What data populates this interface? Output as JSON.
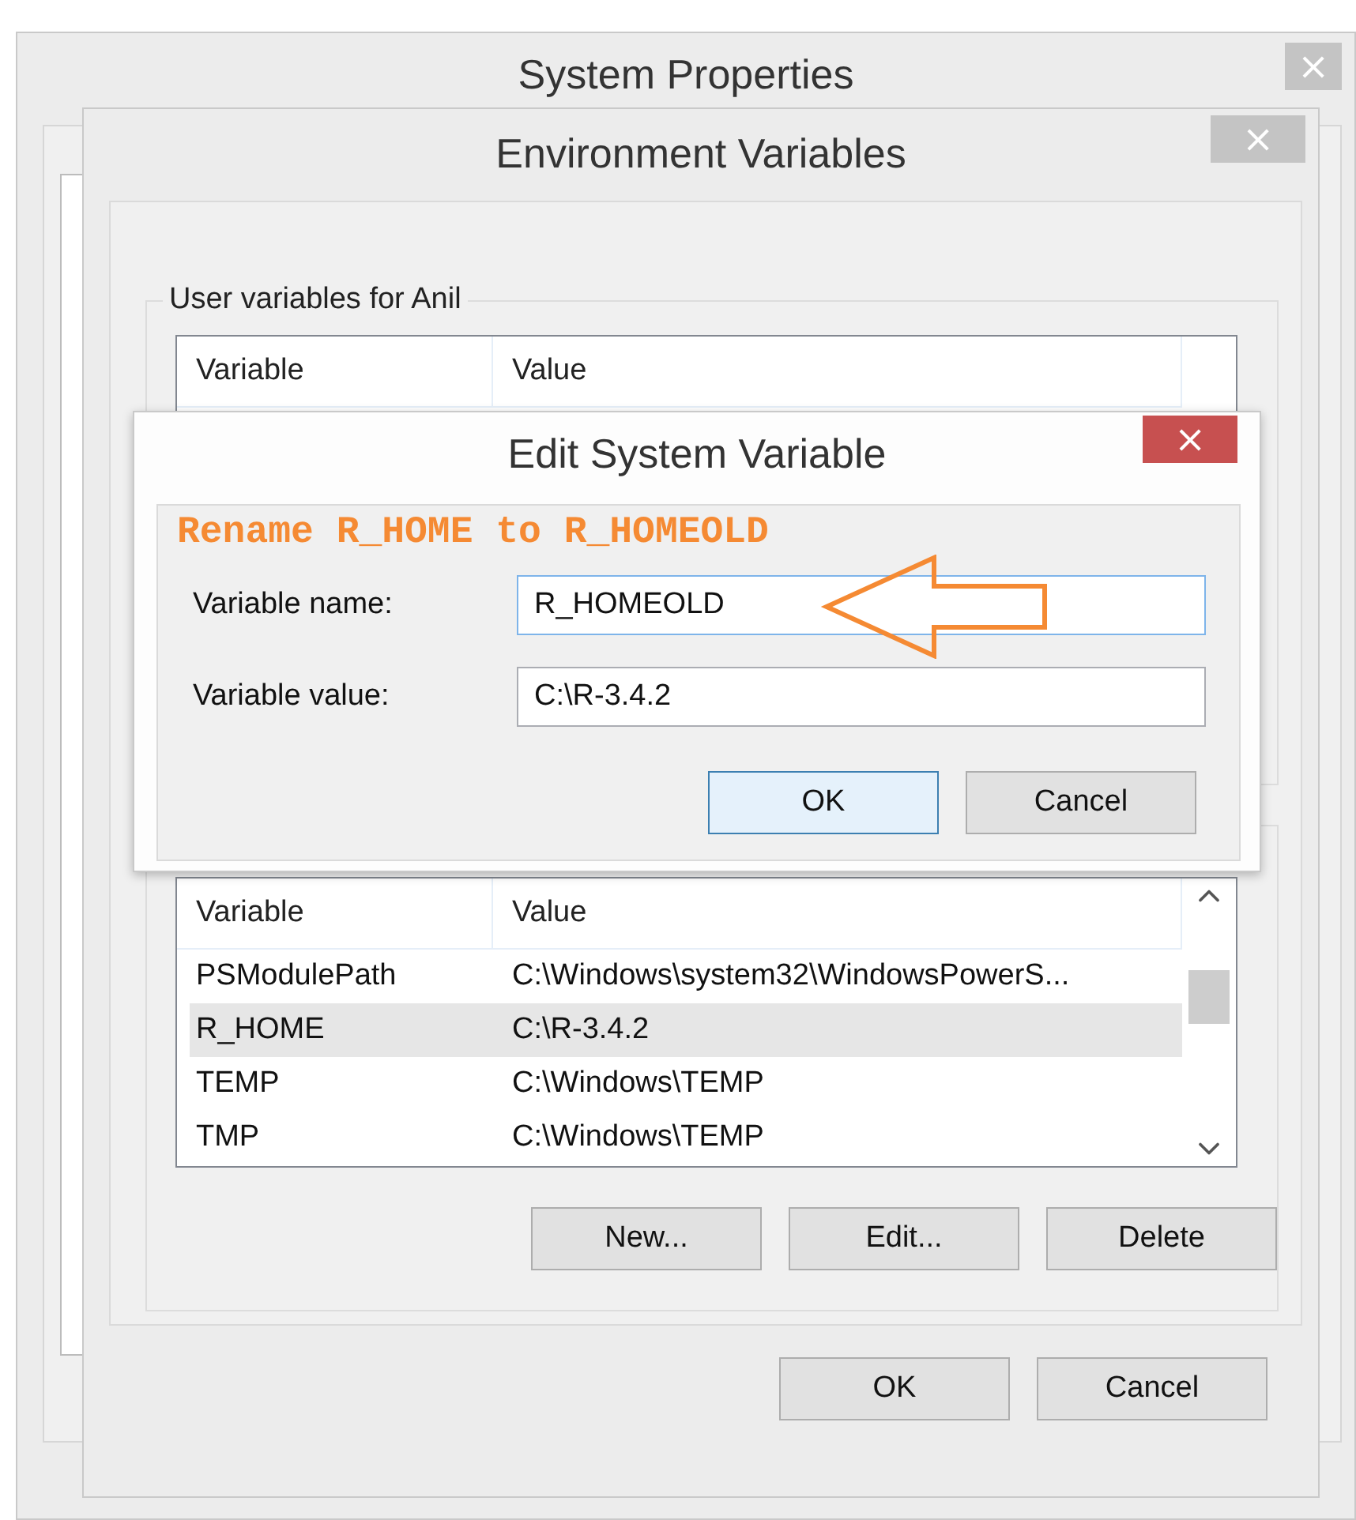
{
  "system_properties": {
    "title": "System Properties",
    "close": "×",
    "active": false
  },
  "environment_variables": {
    "title": "Environment Variables",
    "close": "×",
    "active": false,
    "user_group": {
      "label": "User variables for Anil",
      "columns": [
        "Variable",
        "Value"
      ]
    },
    "system_list": {
      "columns": [
        "Variable",
        "Value"
      ],
      "rows": [
        {
          "variable": "PSModulePath",
          "value": "C:\\Windows\\system32\\WindowsPowerS...",
          "selected": false
        },
        {
          "variable": "R_HOME",
          "value": "C:\\R-3.4.2",
          "selected": true
        },
        {
          "variable": "TEMP",
          "value": "C:\\Windows\\TEMP",
          "selected": false
        },
        {
          "variable": "TMP",
          "value": "C:\\Windows\\TEMP",
          "selected": false
        }
      ]
    },
    "list_buttons": [
      {
        "label": "New...",
        "default": false
      },
      {
        "label": "Edit...",
        "default": false
      },
      {
        "label": "Delete",
        "default": false
      }
    ],
    "buttons": [
      {
        "label": "OK",
        "default": false
      },
      {
        "label": "Cancel",
        "default": false
      }
    ]
  },
  "edit_dialog": {
    "title": "Edit System Variable",
    "close": "×",
    "active": true,
    "annotation": "Rename R_HOME to R_HOMEOLD",
    "fields": [
      {
        "label": "Variable name:",
        "value": "R_HOMEOLD",
        "focused": true
      },
      {
        "label": "Variable value:",
        "value": "C:\\R-3.4.2",
        "focused": false
      }
    ],
    "buttons": [
      {
        "label": "OK",
        "default": true
      },
      {
        "label": "Cancel",
        "default": false
      }
    ]
  }
}
